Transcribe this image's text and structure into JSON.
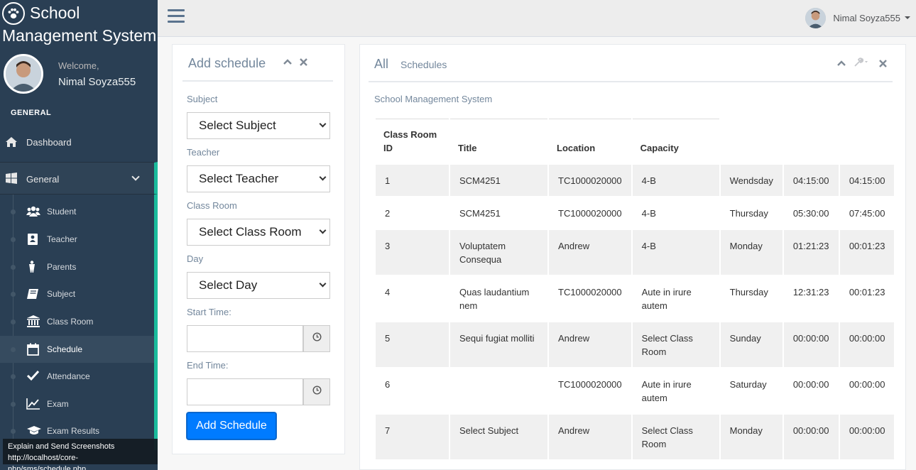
{
  "brand": {
    "line1": "School",
    "line2": "Management System"
  },
  "profile": {
    "welcome": "Welcome,",
    "name": "Nimal Soyza555"
  },
  "sidebar": {
    "section_title": "GENERAL",
    "dashboard": "Dashboard",
    "general": "General",
    "items": [
      {
        "label": "Student",
        "icon": "users-icon"
      },
      {
        "label": "Teacher",
        "icon": "teacher-icon"
      },
      {
        "label": "Parents",
        "icon": "child-icon"
      },
      {
        "label": "Subject",
        "icon": "book-icon"
      },
      {
        "label": "Class Room",
        "icon": "bank-icon"
      },
      {
        "label": "Schedule",
        "icon": "calendar-icon",
        "active": true
      },
      {
        "label": "Attendance",
        "icon": "check-icon"
      },
      {
        "label": "Exam",
        "icon": "chart-line-icon"
      },
      {
        "label": "Exam Results",
        "icon": "graduation-cap-icon"
      }
    ],
    "tooltip": {
      "line1": "Explain and Send Screenshots",
      "line2": "http://localhost/core-php/sms/schedule.php"
    }
  },
  "topnav": {
    "user_name": "Nimal Soyza555"
  },
  "add_schedule": {
    "title": "Add schedule",
    "subject_label": "Subject",
    "subject_value": "Select Subject",
    "teacher_label": "Teacher",
    "teacher_value": "Select Teacher",
    "classroom_label": "Class Room",
    "classroom_value": "Select Class Room",
    "day_label": "Day",
    "day_value": "Select Day",
    "start_label": "Start Time:",
    "end_label": "End Time:",
    "submit_label": "Add Schedule"
  },
  "schedules": {
    "title_main": "All",
    "title_sub": "Schedules",
    "caption": "School Management System",
    "columns": [
      "Class Room ID",
      "Title",
      "Location",
      "Capacity"
    ],
    "rows": [
      [
        "1",
        "SCM4251",
        "TC1000020000",
        "4-B",
        "Wendsday",
        "04:15:00",
        "04:15:00"
      ],
      [
        "2",
        "SCM4251",
        "TC1000020000",
        "4-B",
        "Thursday",
        "05:30:00",
        "07:45:00"
      ],
      [
        "3",
        "Voluptatem Consequa",
        "Andrew",
        "4-B",
        "Monday",
        "01:21:23",
        "00:01:23"
      ],
      [
        "4",
        "Quas laudantium nem",
        "TC1000020000",
        "Aute in irure autem",
        "Thursday",
        "12:31:23",
        "00:01:23"
      ],
      [
        "5",
        "Sequi fugiat molliti",
        "Andrew",
        "Select Class Room",
        "Sunday",
        "00:00:00",
        "00:00:00"
      ],
      [
        "6",
        "",
        "TC1000020000",
        "Aute in irure autem",
        "Saturday",
        "00:00:00",
        "00:00:00"
      ],
      [
        "7",
        "Select Subject",
        "Andrew",
        "Select Class Room",
        "Monday",
        "00:00:00",
        "00:00:00"
      ]
    ]
  },
  "colors": {
    "sidebar_bg": "#2a3f54",
    "accent": "#1abb9c",
    "primary_button": "#007bff"
  }
}
